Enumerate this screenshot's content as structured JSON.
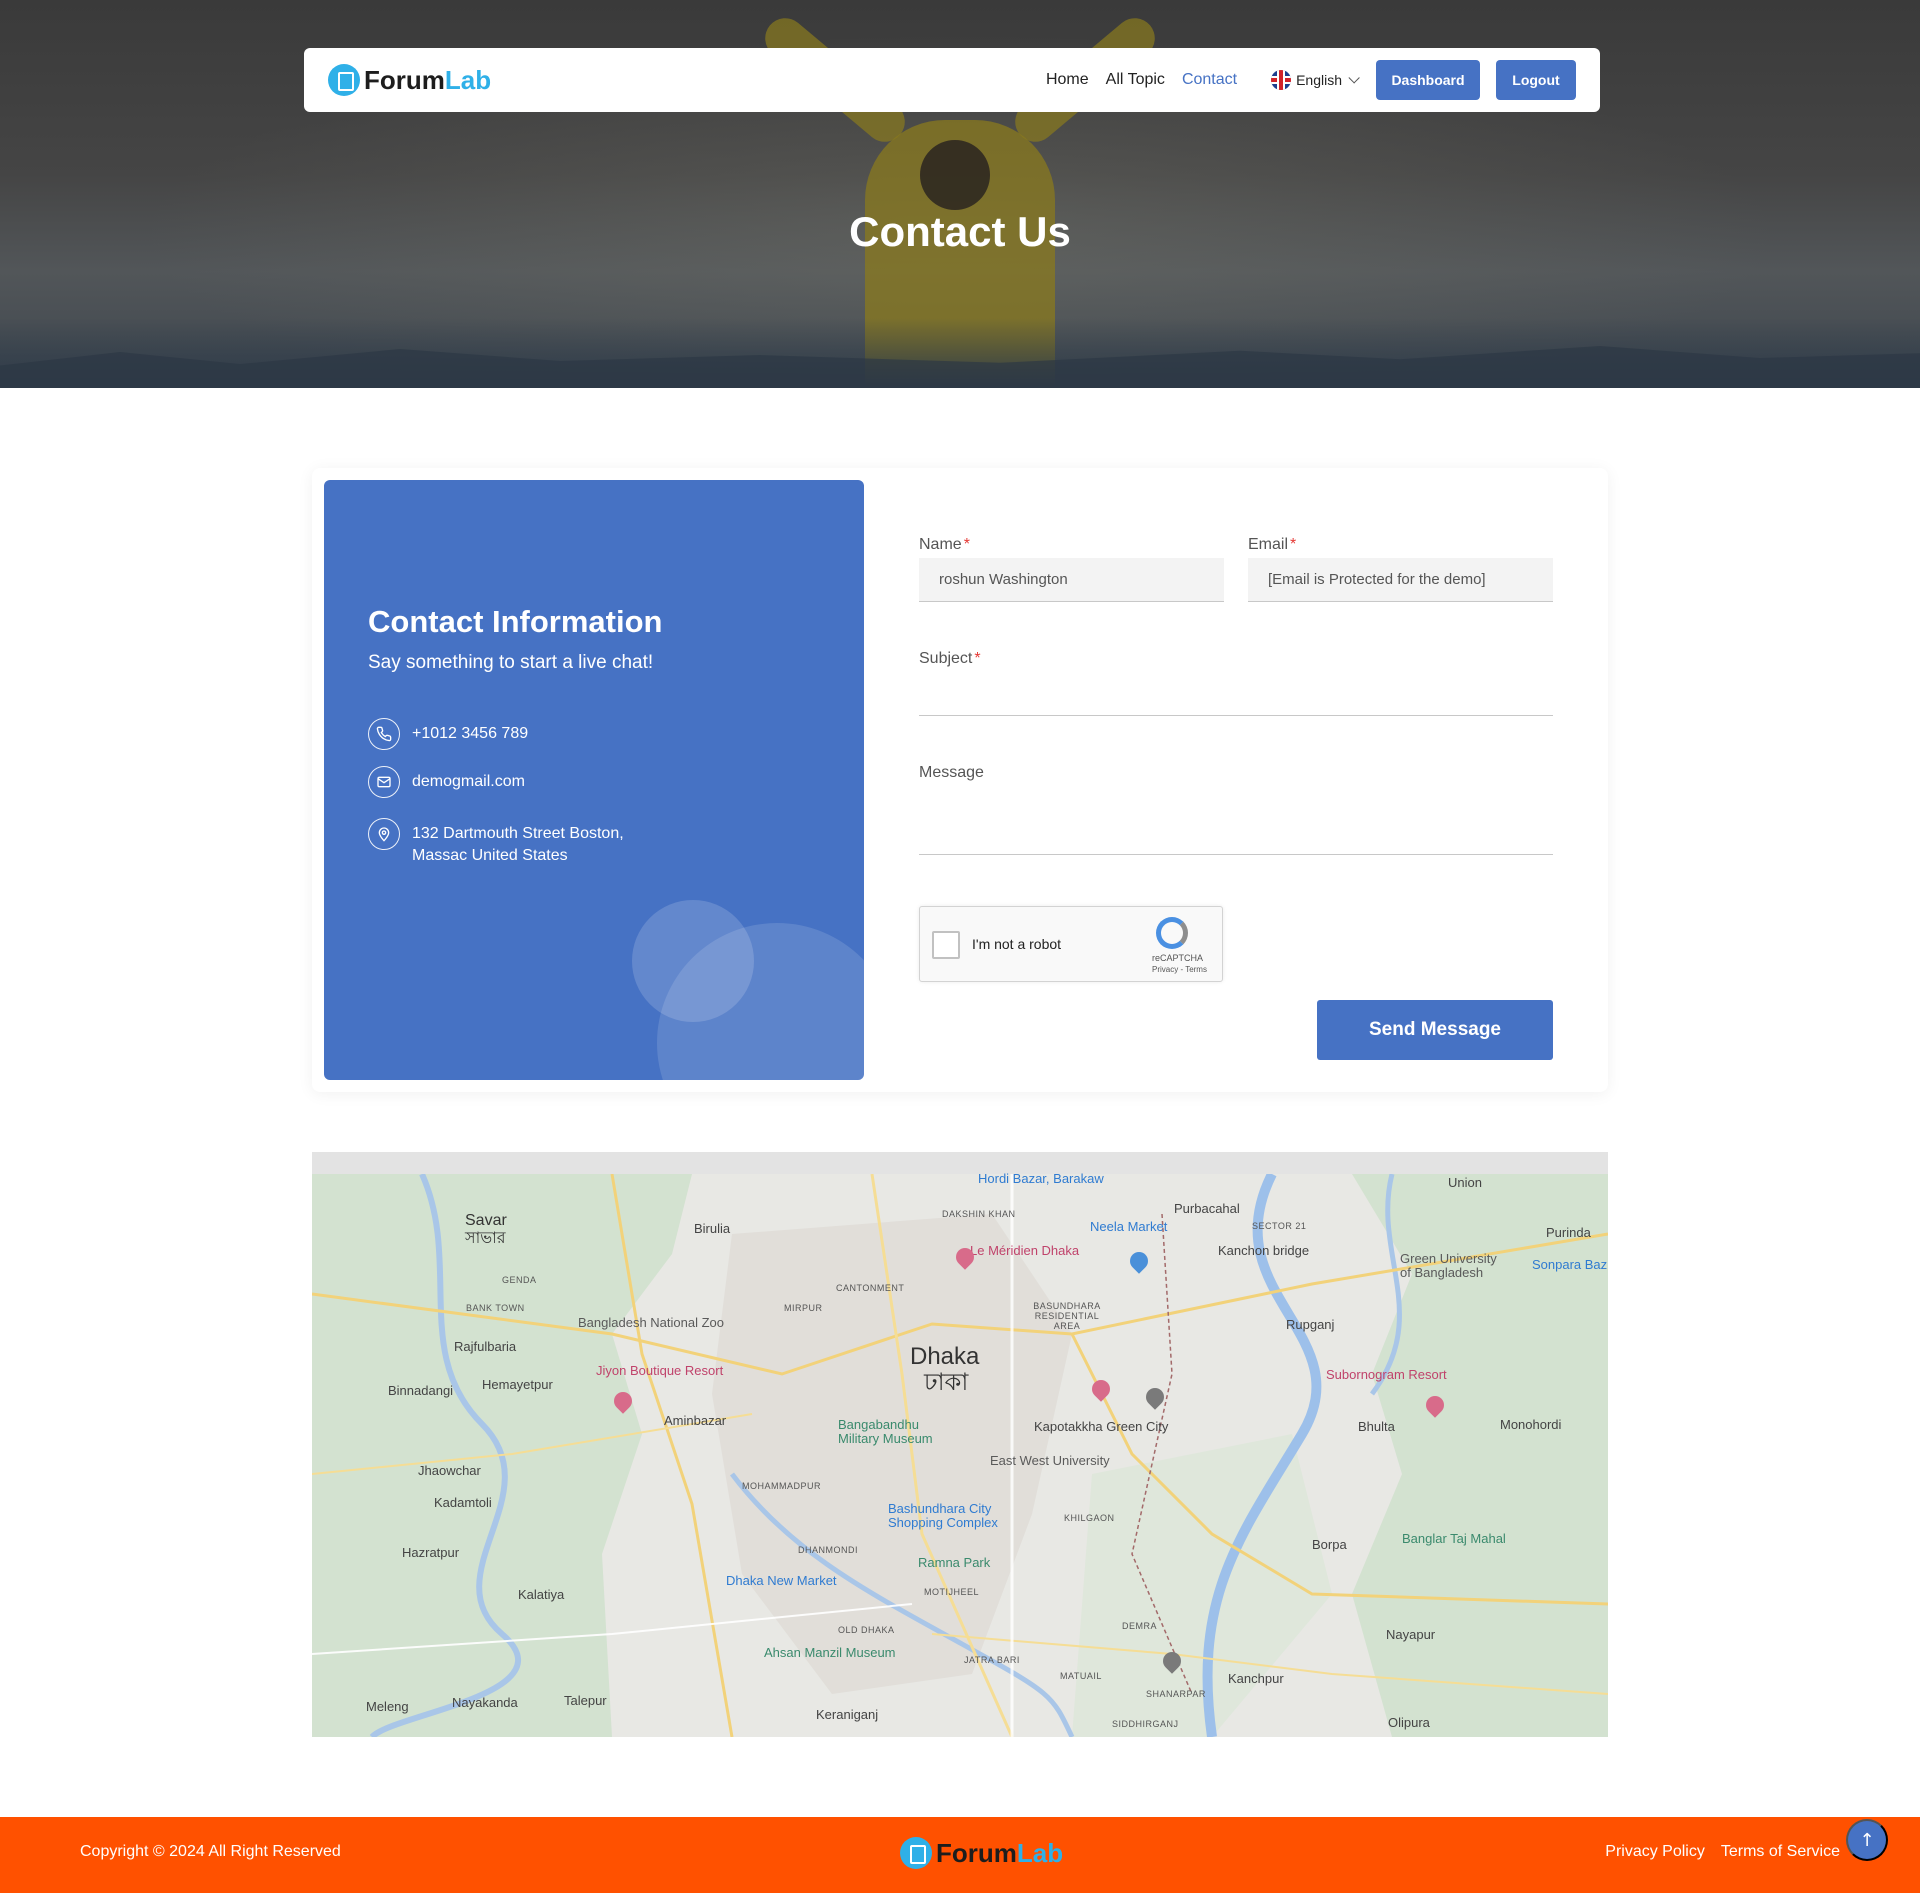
{
  "brand": {
    "name_main": "Forum",
    "name_accent": "Lab"
  },
  "nav": {
    "links": [
      "Home",
      "All Topic",
      "Contact"
    ],
    "active": "Contact",
    "language": "English",
    "dashboard_label": "Dashboard",
    "logout_label": "Logout"
  },
  "hero": {
    "title": "Contact Us"
  },
  "contact_info": {
    "title": "Contact Information",
    "subtitle": "Say something to start a live chat!",
    "phone": "+1012 3456 789",
    "email": "demogmail.com",
    "address_line1": "132 Dartmouth Street Boston,",
    "address_line2": "Massac United States",
    "icons": {
      "phone": "phone-icon",
      "email": "mail-icon",
      "address": "location-pin-icon"
    }
  },
  "form": {
    "name_label": "Name",
    "name_value": "roshun Washington",
    "email_label": "Email",
    "email_value": "[Email is Protected for the demo]",
    "subject_label": "Subject",
    "subject_value": "",
    "message_label": "Message",
    "message_value": "",
    "required_mark": "*",
    "captcha_label": "I'm not a robot",
    "captcha_brand": "reCAPTCHA",
    "captcha_terms": "Privacy - Terms",
    "submit_label": "Send Message"
  },
  "map": {
    "labels": {
      "dhaka": "Dhaka",
      "dhaka_bn": "ঢাকা",
      "savar": "Savar",
      "savar_bn": "সাভার",
      "birulia": "Birulia",
      "purbacahal": "Purbacahal",
      "union": "Union",
      "purinda": "Purinda",
      "hordi": "Hordi Bazar, Barakaw",
      "neela": "Neela Market",
      "meridien": "Le Méridien Dhaka",
      "kanchon": "Kanchon bridge",
      "green_univ": "Green University",
      "green_univ2": "of Bangladesh",
      "sonpara": "Sonpara Baz",
      "zoo": "Bangladesh National Zoo",
      "rajfulbaria": "Rajfulbaria",
      "rupganj": "Rupganj",
      "binnadangi": "Binnadangi",
      "hemayetpur": "Hemayetpur",
      "jiyon": "Jiyon Boutique Resort",
      "subornogram": "Subornogram Resort",
      "aminbazar": "Aminbazar",
      "bangabandhu": "Bangabandhu",
      "military": "Military Museum",
      "kapotakkha": "Kapotakkha Green City",
      "bhulta": "Bhulta",
      "monohordi": "Monohordi",
      "jhaowchar": "Jhaowchar",
      "ewu": "East West University",
      "kadamtoli": "Kadamtoli",
      "bashundhara": "Bashundhara City",
      "bashundhara2": "Shopping Complex",
      "banglar": "Banglar Taj Mahal",
      "hazratpur": "Hazratpur",
      "ramna": "Ramna Park",
      "borpa": "Borpa",
      "kalatiya": "Kalatiya",
      "newmarket": "Dhaka New Market",
      "nayapur": "Nayapur",
      "ahsan": "Ahsan Manzil Museum",
      "jatrabari": "JATRA BARI",
      "demra": "DEMRA",
      "kanchpur": "Kanchpur",
      "meleng": "Meleng",
      "nayakanda": "Nayakanda",
      "talepur": "Talepur",
      "keraniganj": "Keraniganj",
      "olipura": "Olipura",
      "cantonment": "CANTONMENT",
      "mirpur": "MIRPUR",
      "dakshin": "DAKSHIN KHAN",
      "basundhara_ra": "BASUNDHARA RESIDENTIAL AREA",
      "khilgaon": "KHILGAON",
      "mohammadpur": "MOHAMMADPUR",
      "dhanmondi": "DHANMONDI",
      "motijheel": "MOTIJHEEL",
      "old_dhaka": "OLD DHAKA",
      "shanarpar": "SHANARPAR",
      "matuail": "MATUAIL",
      "siddhirganj": "SIDDHIRGANJ",
      "genda": "GENDA",
      "bank_town": "BANK TOWN",
      "sector21": "SECTOR 21"
    }
  },
  "footer": {
    "copyright": "Copyright © 2024 All Right Reserved",
    "links": [
      "Privacy Policy",
      "Terms of Service"
    ],
    "scroll_top": "↑"
  },
  "colors": {
    "primary": "#4672c4",
    "footer": "#ff5100",
    "logo_accent": "#2fb0e8",
    "required": "#e53935"
  }
}
